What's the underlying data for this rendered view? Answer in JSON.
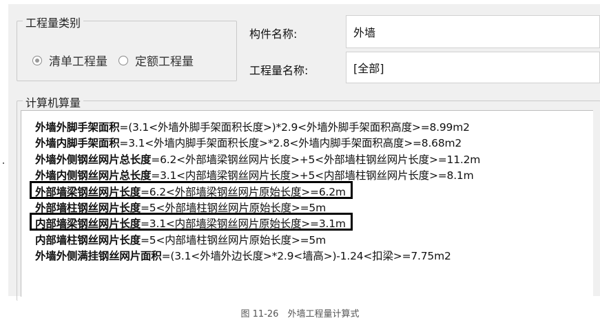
{
  "quantity_type": {
    "group_title": "工程量类别",
    "options": [
      {
        "label": "清单工程量",
        "selected": true
      },
      {
        "label": "定额工程量",
        "selected": false
      }
    ]
  },
  "component": {
    "name_label": "构件名称:",
    "name_value": "外墙",
    "quantity_name_label": "工程量名称:",
    "quantity_name_value": "[全部]"
  },
  "calc": {
    "group_title": "计算机算量",
    "lines": [
      {
        "name": "外墙外脚手架面积",
        "expr": "=(3.1<外墙外脚手架面积长度>)*2.9<外墙外脚手架面积高度>=8.99m2",
        "highlighted": false
      },
      {
        "name": "外墙内脚手架面积",
        "expr": "=3.1<外墙内脚手架面积长度>*2.8<外墙内脚手架面积高度>=8.68m2",
        "highlighted": false
      },
      {
        "name": "外墙外侧钢丝网片总长度",
        "expr": "=6.2<外部墙梁钢丝网片长度>+5<外部墙柱钢丝网片长度>=11.2m",
        "highlighted": false
      },
      {
        "name": "外墙内侧钢丝网片总长度",
        "expr": "=3.1<内部墙梁钢丝网片长度>+5<内部墙柱钢丝网片长度>=8.1m",
        "highlighted": false
      },
      {
        "name": "外部墙梁钢丝网片长度",
        "expr": "=6.2<外部墙梁钢丝网片原始长度>=6.2m",
        "highlighted": true
      },
      {
        "name": "外部墙柱钢丝网片长度",
        "expr": "=5<外部墙柱钢丝网片原始长度>=5m",
        "highlighted": false
      },
      {
        "name": "内部墙梁钢丝网片长度",
        "expr": "=3.1<内部墙梁钢丝网片原始长度>=3.1m",
        "highlighted": true
      },
      {
        "name": "内部墙柱钢丝网片长度",
        "expr": "=5<内部墙柱钢丝网片原始长度>=5m",
        "highlighted": false
      },
      {
        "name": "外墙外侧满挂钢丝网片面积",
        "expr": "=(3.1<外墙外边长度>*2.9<墙高>)-1.24<扣梁>=7.75m2",
        "highlighted": false
      }
    ]
  },
  "caption": "图 11-26　外墙工程量计算式"
}
